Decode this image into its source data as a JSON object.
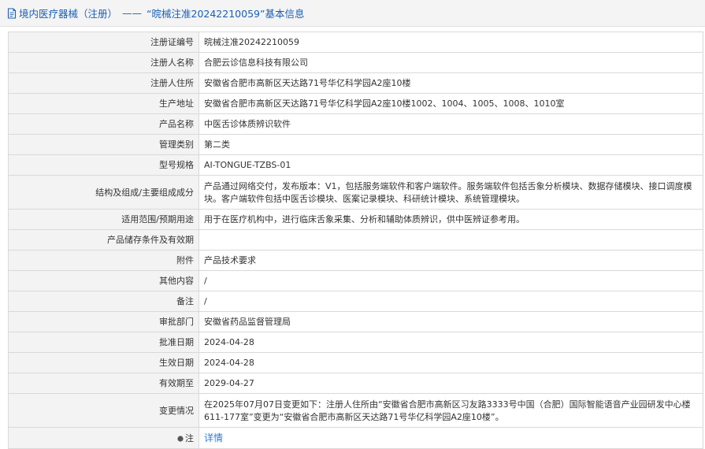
{
  "header": {
    "category": "境内医疗器械（注册）",
    "separator": "——",
    "title": "“晥械注准20242210059”基本信息"
  },
  "rows": [
    {
      "label": "注册证编号",
      "value": "晥械注准20242210059"
    },
    {
      "label": "注册人名称",
      "value": "合肥云诊信息科技有限公司"
    },
    {
      "label": "注册人住所",
      "value": "安徽省合肥市高新区天达路71号华亿科学园A2座10楼"
    },
    {
      "label": "生产地址",
      "value": "安徽省合肥市高新区天达路71号华亿科学园A2座10楼1002、1004、1005、1008、1010室"
    },
    {
      "label": "产品名称",
      "value": "中医舌诊体质辨识软件"
    },
    {
      "label": "管理类别",
      "value": "第二类"
    },
    {
      "label": "型号规格",
      "value": "AI-TONGUE-TZBS-01"
    },
    {
      "label": "结构及组成/主要组成成分",
      "value": "产品通过网络交付，发布版本：V1，包括服务端软件和客户端软件。服务端软件包括舌象分析模块、数据存储模块、接口调度模块。客户端软件包括中医舌诊模块、医案记录模块、科研统计模块、系统管理模块。"
    },
    {
      "label": "适用范围/预期用途",
      "value": "用于在医疗机构中，进行临床舌象采集、分析和辅助体质辨识，供中医辨证参考用。"
    },
    {
      "label": "产品储存条件及有效期",
      "value": ""
    },
    {
      "label": "附件",
      "value": "产品技术要求"
    },
    {
      "label": "其他内容",
      "value": "/"
    },
    {
      "label": "备注",
      "value": "/"
    },
    {
      "label": "审批部门",
      "value": "安徽省药品监督管理局"
    },
    {
      "label": "批准日期",
      "value": "2024-04-28"
    },
    {
      "label": "生效日期",
      "value": "2024-04-28"
    },
    {
      "label": "有效期至",
      "value": "2029-04-27"
    },
    {
      "label": "变更情况",
      "value": "在2025年07月07日变更如下：注册人住所由“安徽省合肥市高新区习友路3333号中国（合肥）国际智能语音产业园研发中心楼611-177室”变更为“安徽省合肥市高新区天达路71号华亿科学园A2座10楼”。"
    }
  ],
  "note_row": {
    "label": "注",
    "link": "详情"
  },
  "icons": {
    "header": "document-icon",
    "note": "pin-icon"
  },
  "colors": {
    "link": "#2b7bd3",
    "title": "#1a5fb4",
    "label_bg": "#f3f3f3",
    "border": "#d9d9d9"
  }
}
